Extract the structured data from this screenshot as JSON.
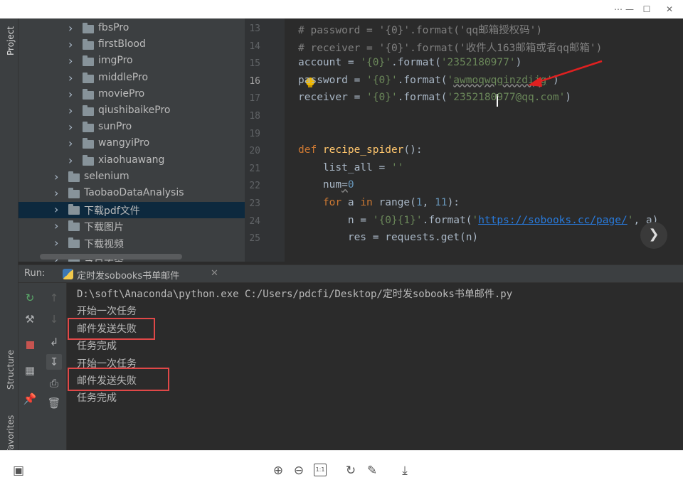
{
  "window": {
    "controls": [
      "⋯",
      "—",
      "☐",
      "✕"
    ]
  },
  "sidebar": {
    "project_tab": "Project",
    "structure_tab": "Structure",
    "favorites_tab": "Favorites"
  },
  "project_tree": {
    "items": [
      {
        "label": "fbsPro",
        "indent": 2,
        "selected": false
      },
      {
        "label": "firstBlood",
        "indent": 2,
        "selected": false
      },
      {
        "label": "imgPro",
        "indent": 2,
        "selected": false
      },
      {
        "label": "middlePro",
        "indent": 2,
        "selected": false
      },
      {
        "label": "moviePro",
        "indent": 2,
        "selected": false
      },
      {
        "label": "qiushibaikePro",
        "indent": 2,
        "selected": false
      },
      {
        "label": "sunPro",
        "indent": 2,
        "selected": false
      },
      {
        "label": "wangyiPro",
        "indent": 2,
        "selected": false
      },
      {
        "label": "xiaohuawang",
        "indent": 2,
        "selected": false
      },
      {
        "label": "selenium",
        "indent": 1,
        "selected": false
      },
      {
        "label": "TaobaoDataAnalysis",
        "indent": 1,
        "selected": false
      },
      {
        "label": "下载pdf文件",
        "indent": 1,
        "selected": true
      },
      {
        "label": "下载图片",
        "indent": 1,
        "selected": false
      },
      {
        "label": "下载视频",
        "indent": 1,
        "selected": false
      },
      {
        "label": "今日头条",
        "indent": 1,
        "selected": false
      }
    ]
  },
  "editor": {
    "lines": [
      {
        "no": "13",
        "tokens": [
          {
            "t": "# password = '{0}'.format('qq邮箱授权码')",
            "c": "c-cmt"
          }
        ]
      },
      {
        "no": "14",
        "tokens": [
          {
            "t": "# receiver = '{0}'.format('收件人163邮箱或者qq邮箱')",
            "c": "c-cmt"
          }
        ]
      },
      {
        "no": "15",
        "tokens": [
          {
            "t": "account = ",
            "c": ""
          },
          {
            "t": "'{0}'",
            "c": "c-str"
          },
          {
            "t": ".format(",
            "c": ""
          },
          {
            "t": "'2352180977'",
            "c": "c-str"
          },
          {
            "t": ")",
            "c": ""
          }
        ]
      },
      {
        "no": "16",
        "tokens": [
          {
            "t": "password = ",
            "c": ""
          },
          {
            "t": "'{0}'",
            "c": "c-str"
          },
          {
            "t": ".format(",
            "c": ""
          },
          {
            "t": "'",
            "c": "c-str"
          },
          {
            "t": "awmoqwqginzdijg",
            "c": "c-str c-ul"
          },
          {
            "t": "'",
            "c": "c-str"
          },
          {
            "t": ")",
            "c": ""
          }
        ]
      },
      {
        "no": "17",
        "tokens": [
          {
            "t": "receiver = ",
            "c": ""
          },
          {
            "t": "'{0}'",
            "c": "c-str"
          },
          {
            "t": ".format(",
            "c": ""
          },
          {
            "t": "'2352180977@qq.com'",
            "c": "c-str"
          },
          {
            "t": ")",
            "c": ""
          }
        ]
      },
      {
        "no": "18",
        "tokens": []
      },
      {
        "no": "19",
        "tokens": []
      },
      {
        "no": "20",
        "tokens": [
          {
            "t": "def ",
            "c": "c-kw"
          },
          {
            "t": "recipe_spider",
            "c": "c-fn"
          },
          {
            "t": "():",
            "c": ""
          }
        ]
      },
      {
        "no": "21",
        "tokens": [
          {
            "t": "    list_all = ",
            "c": ""
          },
          {
            "t": "''",
            "c": "c-str"
          }
        ]
      },
      {
        "no": "22",
        "tokens": [
          {
            "t": "    num",
            "c": ""
          },
          {
            "t": "=",
            "c": "c-ul"
          },
          {
            "t": "0",
            "c": "c-num"
          }
        ]
      },
      {
        "no": "23",
        "tokens": [
          {
            "t": "    for ",
            "c": "c-kw"
          },
          {
            "t": "a ",
            "c": ""
          },
          {
            "t": "in ",
            "c": "c-kw"
          },
          {
            "t": "range(",
            "c": ""
          },
          {
            "t": "1",
            "c": "c-num"
          },
          {
            "t": ", ",
            "c": ""
          },
          {
            "t": "11",
            "c": "c-num"
          },
          {
            "t": "):",
            "c": ""
          }
        ]
      },
      {
        "no": "24",
        "tokens": [
          {
            "t": "        n = ",
            "c": ""
          },
          {
            "t": "'{0}{1}'",
            "c": "c-str"
          },
          {
            "t": ".format(",
            "c": ""
          },
          {
            "t": "'",
            "c": "c-str"
          },
          {
            "t": "https://sobooks.cc/page/",
            "c": "c-url"
          },
          {
            "t": "'",
            "c": "c-str"
          },
          {
            "t": ", a)",
            "c": ""
          }
        ]
      },
      {
        "no": "25",
        "tokens": [
          {
            "t": "        res = requests.get(n)",
            "c": ""
          }
        ]
      }
    ]
  },
  "run": {
    "label": "Run:",
    "tab_title": "定时发sobooks书单邮件",
    "output": [
      "D:\\soft\\Anaconda\\python.exe C:/Users/pdcfi/Desktop/定时发sobooks书单邮件.py",
      "开始一次任务",
      "邮件发送失败",
      "任务完成",
      "开始一次任务",
      "邮件发送失败",
      "任务完成"
    ]
  },
  "colors": {
    "annotation_red": "#e04848",
    "selected_row": "#0d293e"
  }
}
